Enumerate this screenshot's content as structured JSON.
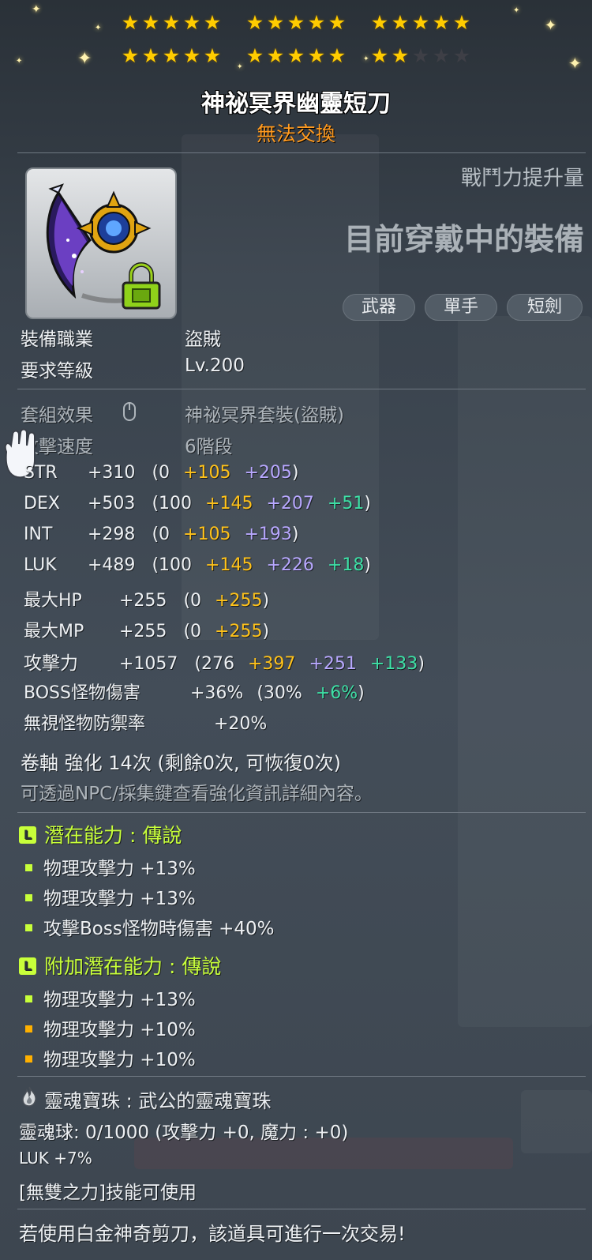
{
  "stars": {
    "row1": [
      5,
      5,
      5
    ],
    "row2": [
      5,
      5,
      5
    ],
    "filled": 22,
    "total": 25
  },
  "item": {
    "name": "神祕冥界幽靈短刀",
    "trade_status": "無法交換"
  },
  "power": {
    "label": "戰鬥力提升量",
    "status": "目前穿戴中的裝備"
  },
  "tags": [
    "武器",
    "單手",
    "短劍"
  ],
  "requirements": {
    "job_label": "裝備職業",
    "job_value": "盜賊",
    "level_label": "要求等級",
    "level_value": "Lv.200"
  },
  "set_effect": {
    "label": "套組效果",
    "value": "神祕冥界套裝(盜賊)"
  },
  "attack_speed": {
    "label": "攻擊速度",
    "value": "6階段"
  },
  "stats": [
    {
      "name": "STR",
      "total": "+310",
      "open": "(0",
      "p1": "+105",
      "p2": "+205",
      "p3": "",
      "close": ")"
    },
    {
      "name": "DEX",
      "total": "+503",
      "open": "(100",
      "p1": "+145",
      "p2": "+207",
      "p3": "+51",
      "close": ")"
    },
    {
      "name": "INT",
      "total": "+298",
      "open": "(0",
      "p1": "+105",
      "p2": "+193",
      "p3": "",
      "close": ")"
    },
    {
      "name": "LUK",
      "total": "+489",
      "open": "(100",
      "p1": "+145",
      "p2": "+226",
      "p3": "+18",
      "close": ")"
    },
    {
      "name": "最大HP",
      "total": "+255",
      "open": "(0",
      "p1": "+255",
      "p2": "",
      "p3": "",
      "close": ")"
    },
    {
      "name": "最大MP",
      "total": "+255",
      "open": "(0",
      "p1": "+255",
      "p2": "",
      "p3": "",
      "close": ")"
    },
    {
      "name": "攻擊力",
      "total": "+1057",
      "open": "(276",
      "p1": "+397",
      "p2": "+251",
      "p3": "+133",
      "close": ")"
    },
    {
      "name": "BOSS怪物傷害",
      "total": "+36%",
      "open": "(30%",
      "p1": "",
      "p2": "",
      "p3": "+6%",
      "close": ")"
    }
  ],
  "ignore_def": {
    "label": "無視怪物防禦率",
    "value": "+20%"
  },
  "scroll": {
    "text": "卷軸 強化 14次 (剩餘0次, 可恢復0次)",
    "hint": "可透過NPC/採集鍵查看強化資訊詳細內容。"
  },
  "potential": {
    "title": "潛在能力 : 傳說",
    "lines": [
      {
        "text": "物理攻擊力 +13%",
        "color": "#c8ff3a"
      },
      {
        "text": "物理攻擊力 +13%",
        "color": "#c8ff3a"
      },
      {
        "text": "攻擊Boss怪物時傷害 +40%",
        "color": "#c8ff3a"
      }
    ]
  },
  "bonus_potential": {
    "title": "附加潛在能力 : 傳說",
    "lines": [
      {
        "text": "物理攻擊力 +13%",
        "color": "#c8ff3a"
      },
      {
        "text": "物理攻擊力 +10%",
        "color": "#ffb000"
      },
      {
        "text": "物理攻擊力 +10%",
        "color": "#ffb000"
      }
    ]
  },
  "soul": {
    "title": "靈魂寶珠 : 武公的靈魂寶珠",
    "orb": "靈魂球: 0/1000 (攻擊力 +0, 魔力 : +0)",
    "luk": "LUK +7%",
    "skill": "[無雙之力]技能可使用"
  },
  "footer": "若使用白金神奇剪刀，該道具可進行一次交易!",
  "icons": {
    "lock": "lock-icon",
    "mouse": "mouse-icon",
    "flame": "flame-icon",
    "glove": "glove-icon"
  }
}
